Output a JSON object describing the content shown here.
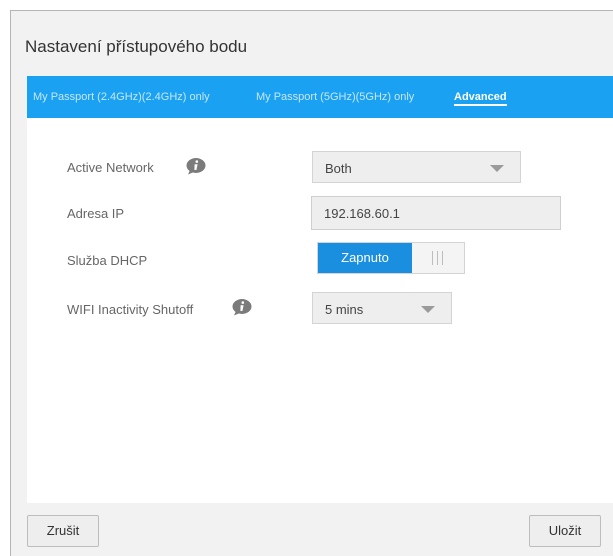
{
  "dialog": {
    "title": "Nastavení přístupového bodu"
  },
  "tabs": [
    {
      "label": "My Passport (2.4GHz)(2.4GHz) only",
      "active": false
    },
    {
      "label": "My Passport (5GHz)(5GHz) only",
      "active": false
    },
    {
      "label": "Advanced",
      "active": true
    }
  ],
  "form": {
    "active_network": {
      "label": "Active Network",
      "value": "Both",
      "icon": "info-icon"
    },
    "ip_address": {
      "label": "Adresa IP",
      "value": "192.168.60.1"
    },
    "dhcp": {
      "label": "Služba DHCP",
      "state_label": "Zapnuto",
      "enabled": true
    },
    "wifi_shutoff": {
      "label": "WIFI Inactivity Shutoff",
      "value": "5 mins",
      "icon": "info-icon"
    }
  },
  "footer": {
    "cancel_label": "Zrušit",
    "save_label": "Uložit"
  },
  "colors": {
    "accent": "#1aa1f2",
    "toggle_on": "#1a8fe0"
  }
}
